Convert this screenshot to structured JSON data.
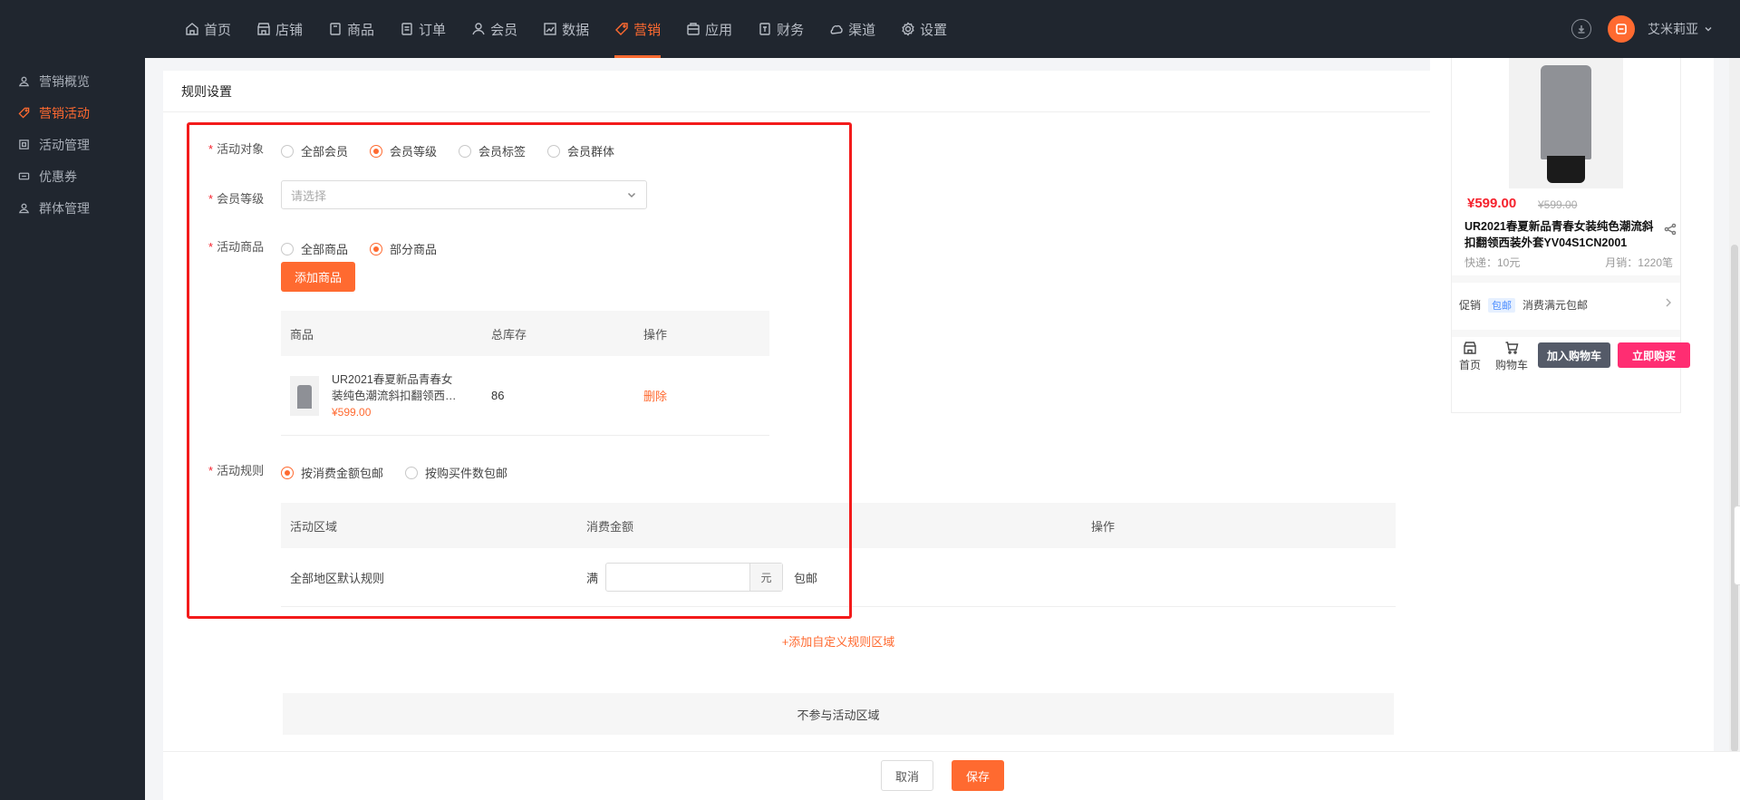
{
  "nav": {
    "items": [
      {
        "label": "首页",
        "icon": "home-icon"
      },
      {
        "label": "店铺",
        "icon": "store-icon"
      },
      {
        "label": "商品",
        "icon": "goods-icon"
      },
      {
        "label": "订单",
        "icon": "order-icon"
      },
      {
        "label": "会员",
        "icon": "member-icon"
      },
      {
        "label": "数据",
        "icon": "chart-icon"
      },
      {
        "label": "营销",
        "icon": "tag-icon",
        "active": true
      },
      {
        "label": "应用",
        "icon": "app-icon"
      },
      {
        "label": "财务",
        "icon": "finance-icon"
      },
      {
        "label": "渠道",
        "icon": "channel-icon"
      },
      {
        "label": "设置",
        "icon": "gear-icon"
      }
    ],
    "user_name": "艾米莉亚",
    "accent": "#ff6a30"
  },
  "sidebar": {
    "items": [
      {
        "label": "营销概览"
      },
      {
        "label": "营销活动",
        "active": true
      },
      {
        "label": "活动管理"
      },
      {
        "label": "优惠券"
      },
      {
        "label": "群体管理"
      }
    ]
  },
  "card": {
    "title": "规则设置"
  },
  "form": {
    "target": {
      "label": "活动对象",
      "options": [
        "全部会员",
        "会员等级",
        "会员标签",
        "会员群体"
      ],
      "selected": "会员等级"
    },
    "level": {
      "label": "会员等级",
      "placeholder": "请选择"
    },
    "goods": {
      "label": "活动商品",
      "options": [
        "全部商品",
        "部分商品"
      ],
      "selected": "部分商品",
      "add_button": "添加商品",
      "headers": [
        "商品",
        "总库存",
        "操作"
      ],
      "rows": [
        {
          "name": "UR2021春夏新品青春女装纯色潮流斜扣翻领西装外套YV04S1CN2001",
          "price": "¥599.00",
          "stock": "86",
          "action": "删除"
        }
      ]
    },
    "rule": {
      "label": "活动规则",
      "options": [
        "按消费金额包邮",
        "按购买件数包邮"
      ],
      "selected": "按消费金额包邮",
      "headers": [
        "活动区域",
        "消费金额",
        "操作"
      ],
      "rows": [
        {
          "region": "全部地区默认规则",
          "prefix": "满",
          "unit": "元",
          "suffix": "包邮"
        }
      ],
      "add_region": "+添加自定义规则区域",
      "exclude": "不参与活动区域"
    },
    "required_mark": "*"
  },
  "footer": {
    "cancel": "取消",
    "save": "保存"
  },
  "preview": {
    "price": "¥599.00",
    "old_price": "¥599.00",
    "title": "UR2021春夏新品青春女装纯色潮流斜扣翻领西装外套YV04S1CN2001",
    "shipping": "快递：10元",
    "sales": "月销：1220笔",
    "promo_label": "促销",
    "promo_tag": "包邮",
    "promo_text": "消费满元包邮",
    "home": "首页",
    "cart": "购物车",
    "add_cart": "加入购物车",
    "buy_now": "立即购买"
  }
}
